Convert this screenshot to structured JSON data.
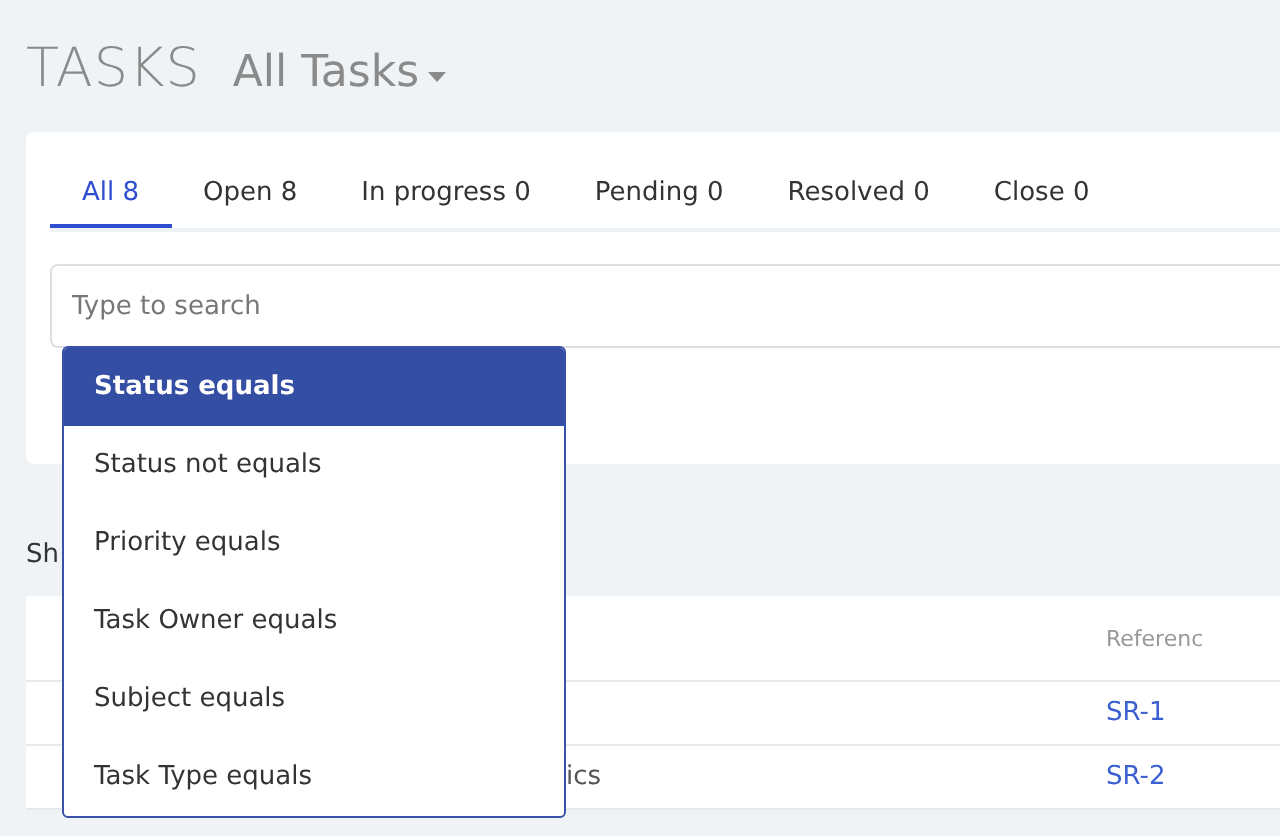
{
  "header": {
    "title": "TASKS",
    "view": "All Tasks"
  },
  "tabs": [
    {
      "label": "All 8",
      "selected": true
    },
    {
      "label": "Open 8",
      "selected": false
    },
    {
      "label": "In progress 0",
      "selected": false
    },
    {
      "label": "Pending 0",
      "selected": false
    },
    {
      "label": "Resolved 0",
      "selected": false
    },
    {
      "label": "Close 0",
      "selected": false
    }
  ],
  "search": {
    "placeholder": "Type to search"
  },
  "filter_menu": [
    {
      "label": "Status equals",
      "selected": true
    },
    {
      "label": "Status not equals",
      "selected": false
    },
    {
      "label": "Priority equals",
      "selected": false
    },
    {
      "label": "Task Owner equals",
      "selected": false
    },
    {
      "label": "Subject equals",
      "selected": false
    },
    {
      "label": "Task Type equals",
      "selected": false
    }
  ],
  "summary": "Sh",
  "table": {
    "columns": [
      "Referenc"
    ],
    "rows": [
      {
        "reference": "SR-1"
      },
      {
        "column_2": "ics",
        "reference": "SR-2"
      }
    ]
  }
}
